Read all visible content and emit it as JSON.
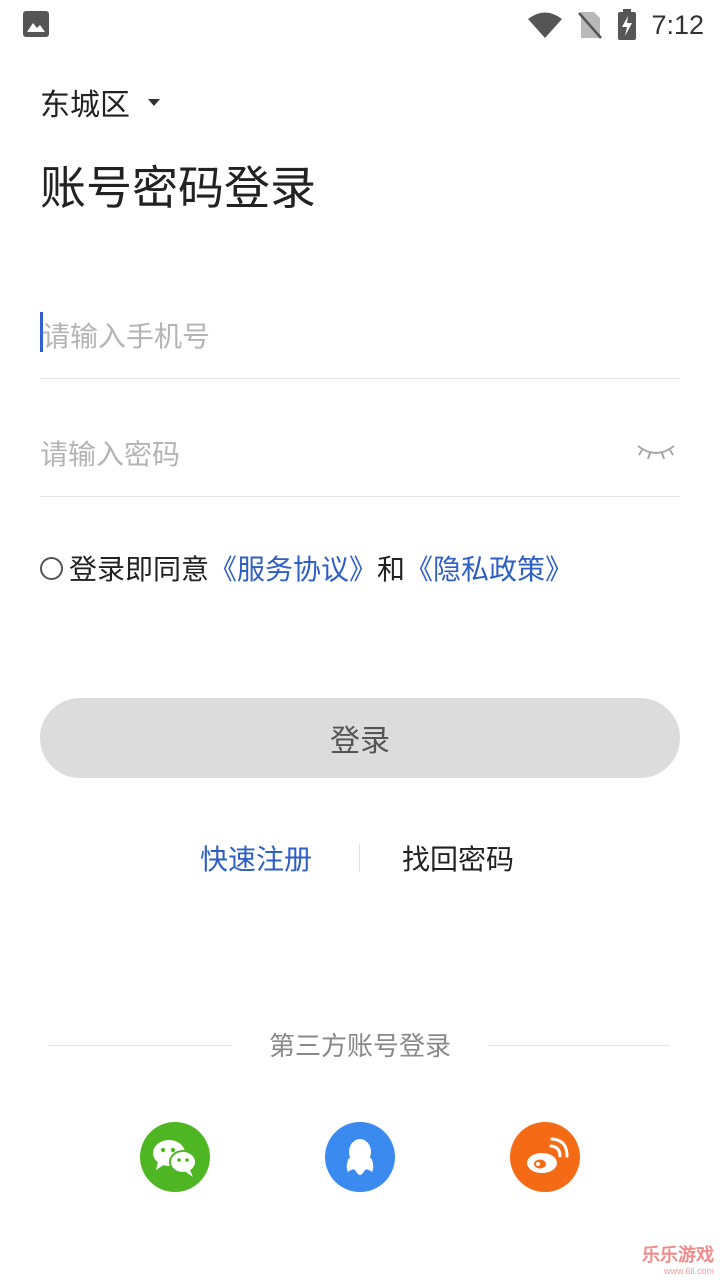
{
  "status_bar": {
    "time": "7:12",
    "icons": [
      "gallery-icon",
      "wifi-icon",
      "no-sim-icon",
      "battery-charging-icon"
    ]
  },
  "header": {
    "district": "东城区",
    "title": "账号密码登录"
  },
  "form": {
    "phone_placeholder": "请输入手机号",
    "password_placeholder": "请输入密码",
    "password_toggle_icon": "eye-closed-icon"
  },
  "agreement": {
    "prefix": "登录即同意",
    "service_link": "《服务协议》",
    "conjunction": "和",
    "privacy_link": "《隐私政策》",
    "checked": false
  },
  "login_button": "登录",
  "links": {
    "register": "快速注册",
    "forgot": "找回密码"
  },
  "third_party": {
    "title": "第三方账号登录",
    "providers": [
      "wechat-icon",
      "qq-icon",
      "weibo-icon"
    ]
  },
  "watermark": {
    "main": "乐乐游戏",
    "sub": "www.6ll.com"
  },
  "colors": {
    "link_blue": "#2e5fc6",
    "button_bg": "#dcdcdc",
    "wechat": "#4fb623",
    "qq": "#3b8af0",
    "weibo": "#f56a14"
  }
}
